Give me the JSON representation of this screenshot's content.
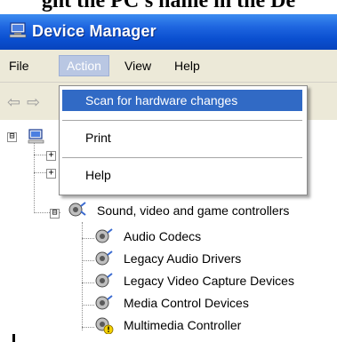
{
  "top_caption": "ght the PC's name in the De",
  "window": {
    "title": "Device Manager"
  },
  "menu": {
    "file": "File",
    "action": "Action",
    "view": "View",
    "help": "Help"
  },
  "toolbar": {
    "back": "⇦",
    "forward": "⇨"
  },
  "tree": {
    "expanders": [
      "⊟",
      "+",
      "+",
      "⊟"
    ],
    "category": "Sound, video and game controllers",
    "children": [
      "Audio Codecs",
      "Legacy Audio Drivers",
      "Legacy Video Capture Devices",
      "Media Control Devices",
      "Multimedia Controller"
    ]
  },
  "action_menu": {
    "items": [
      "Scan for hardware changes",
      "Print",
      "Help"
    ]
  },
  "colors": {
    "titlebar": "#0a4fd0",
    "menu_highlight": "#316ac5",
    "menubar": "#ece9d8"
  }
}
